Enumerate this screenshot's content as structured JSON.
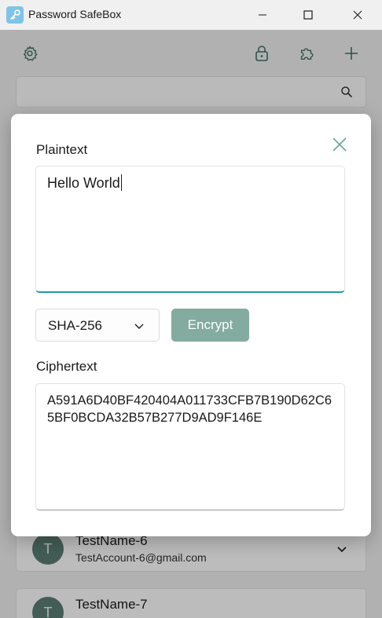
{
  "window": {
    "title": "Password SafeBox",
    "icon": "key-icon"
  },
  "toolbar": {
    "settings_icon": "gear-icon",
    "lock_icon": "lock-icon",
    "puzzle_icon": "puzzle-icon",
    "add_icon": "plus-icon"
  },
  "search": {
    "placeholder": "",
    "value": ""
  },
  "list": {
    "items": [
      {
        "initial": "T",
        "name": "TestName-6",
        "account": "TestAccount-6@gmail.com"
      },
      {
        "initial": "T",
        "name": "TestName-7",
        "account": ""
      }
    ]
  },
  "dialog": {
    "plaintext_label": "Plaintext",
    "plaintext_value": "Hello World",
    "algorithm_selected": "SHA-256",
    "encrypt_label": "Encrypt",
    "ciphertext_label": "Ciphertext",
    "ciphertext_value": "A591A6D40BF420404A011733CFB7B190D62C65BF0BCDA32B57B277D9AD9F146E"
  },
  "colors": {
    "accent": "#1f9aa6",
    "button": "#83ab9f",
    "avatar": "#5a7d73",
    "close_icon": "#6aa89a"
  }
}
